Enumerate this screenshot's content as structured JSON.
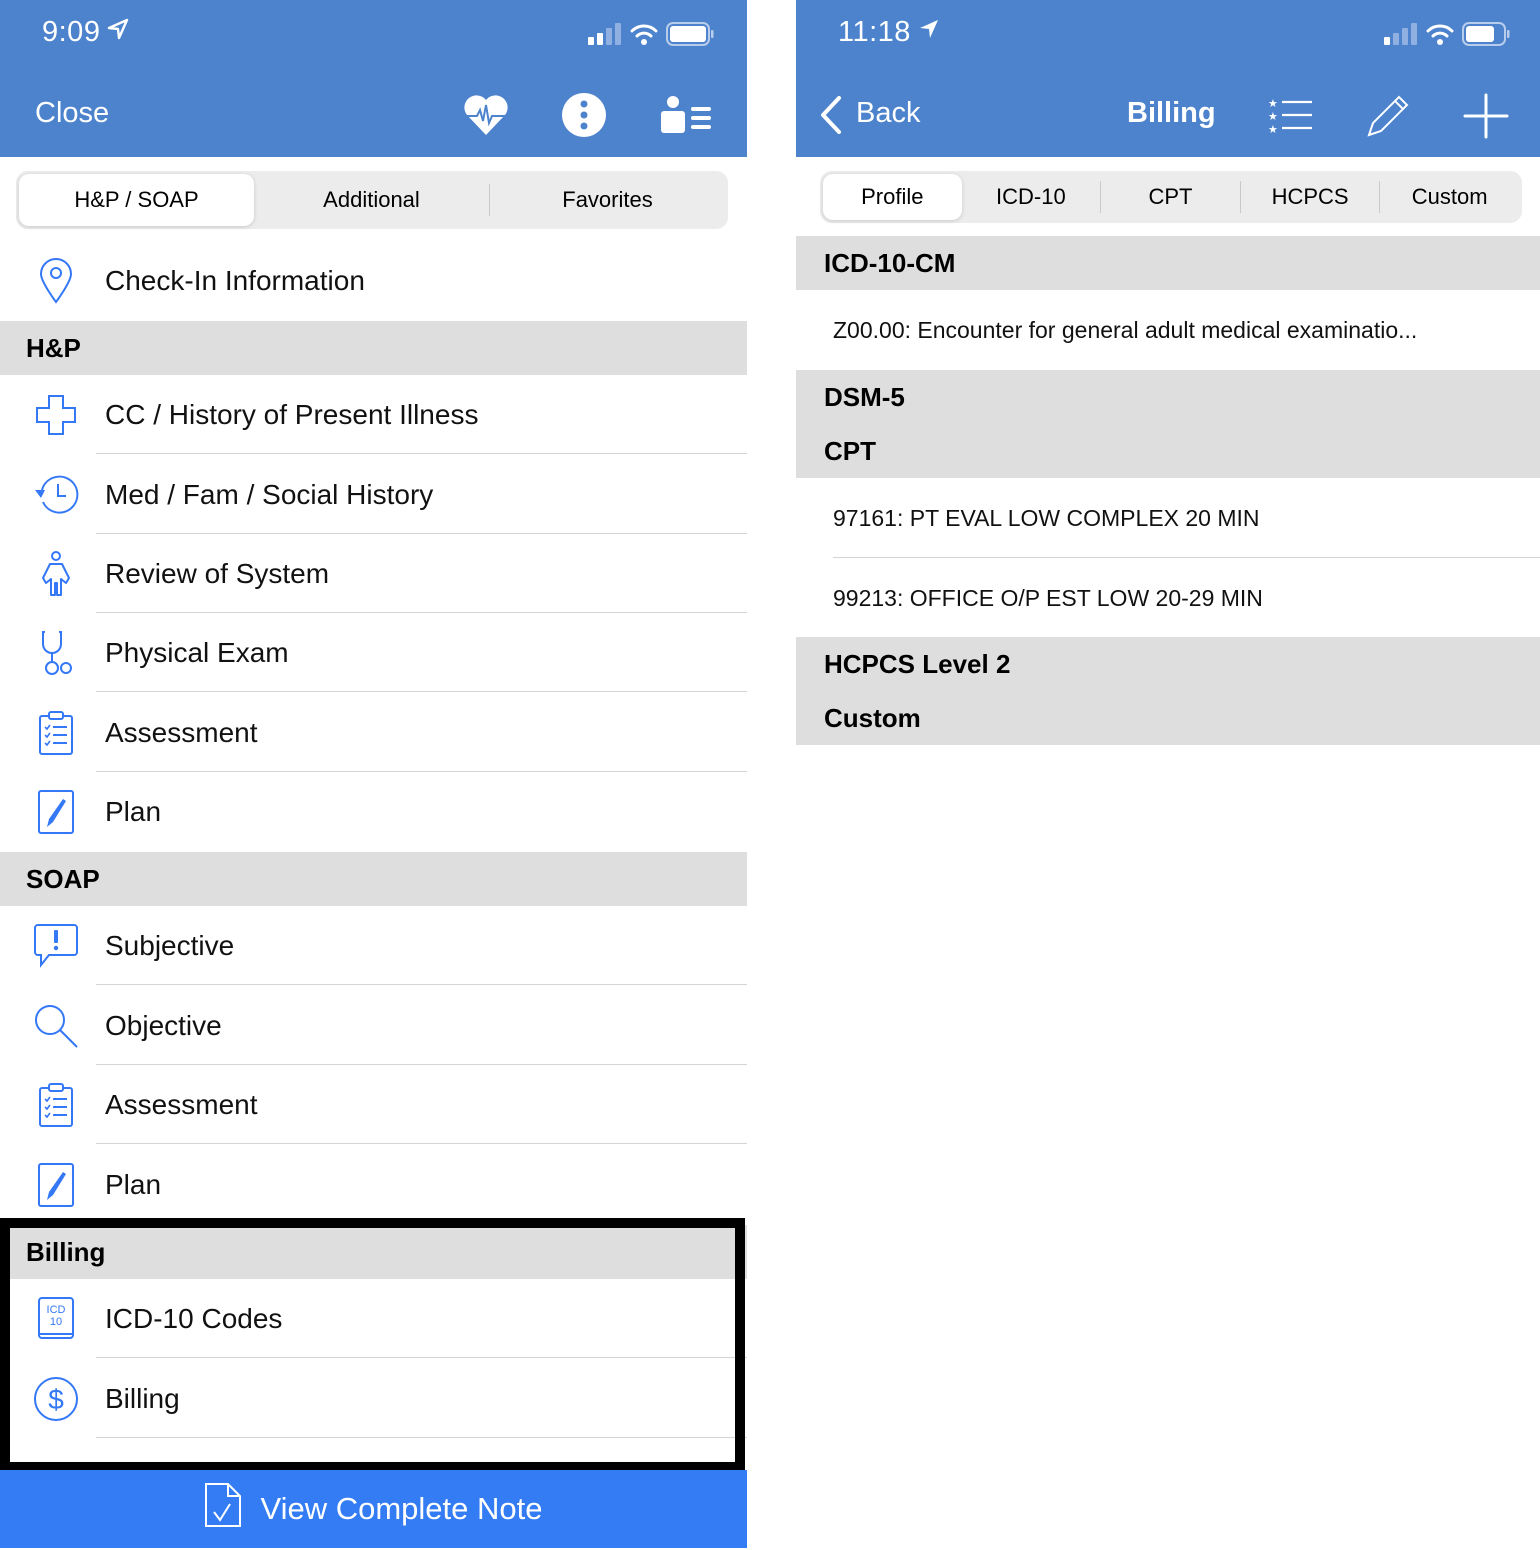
{
  "left": {
    "status": {
      "time": "9:09"
    },
    "nav": {
      "close_label": "Close",
      "icons": [
        "heart-pulse-icon",
        "more-options-icon",
        "patient-list-icon"
      ]
    },
    "tabs": [
      {
        "label": "H&P / SOAP",
        "active": true
      },
      {
        "label": "Additional",
        "active": false
      },
      {
        "label": "Favorites",
        "active": false
      }
    ],
    "checkin": {
      "label": "Check-In Information",
      "icon": "location-pin-icon"
    },
    "sections": {
      "hp": {
        "title": "H&P",
        "items": [
          {
            "label": "CC / History of Present Illness",
            "icon": "medical-cross-icon"
          },
          {
            "label": "Med / Fam / Social History",
            "icon": "history-clock-icon"
          },
          {
            "label": "Review of System",
            "icon": "person-icon"
          },
          {
            "label": "Physical Exam",
            "icon": "stethoscope-icon"
          },
          {
            "label": "Assessment",
            "icon": "clipboard-checklist-icon"
          },
          {
            "label": "Plan",
            "icon": "pen-document-icon"
          }
        ]
      },
      "soap": {
        "title": "SOAP",
        "items": [
          {
            "label": "Subjective",
            "icon": "speech-bubble-exclamation-icon"
          },
          {
            "label": "Objective",
            "icon": "magnifier-icon"
          },
          {
            "label": "Assessment",
            "icon": "clipboard-checklist-icon"
          },
          {
            "label": "Plan",
            "icon": "pen-document-icon"
          }
        ]
      },
      "billing": {
        "title": "Billing",
        "items": [
          {
            "label": "ICD-10 Codes",
            "icon": "icd10-book-icon",
            "icon_text_top": "ICD",
            "icon_text_bottom": "10"
          },
          {
            "label": "Billing",
            "icon": "dollar-circle-icon"
          }
        ]
      }
    },
    "bottom_button": {
      "label": "View Complete Note",
      "icon": "document-check-icon"
    }
  },
  "right": {
    "status": {
      "time": "11:18"
    },
    "nav": {
      "back_label": "Back",
      "title": "Billing",
      "icons": [
        "starred-list-icon",
        "pencil-icon",
        "plus-icon"
      ]
    },
    "tabs": [
      {
        "label": "Profile",
        "active": true
      },
      {
        "label": "ICD-10",
        "active": false
      },
      {
        "label": "CPT",
        "active": false
      },
      {
        "label": "HCPCS",
        "active": false
      },
      {
        "label": "Custom",
        "active": false
      }
    ],
    "sections": [
      {
        "title": "ICD-10-CM",
        "items": [
          "Z00.00: Encounter for general adult medical examinatio..."
        ]
      },
      {
        "title": "DSM-5",
        "items": []
      },
      {
        "title": "CPT",
        "items": [
          "97161: PT EVAL LOW COMPLEX 20 MIN",
          "99213: OFFICE O/P EST LOW 20-29 MIN"
        ]
      },
      {
        "title": "HCPCS Level 2",
        "items": []
      },
      {
        "title": "Custom",
        "items": []
      }
    ]
  },
  "colors": {
    "nav_bar": "#4d83cd",
    "accent_icon": "#3478f6",
    "bottom_button": "#337cf4",
    "section_header": "#dedede",
    "segmented_bg": "#ececec"
  }
}
